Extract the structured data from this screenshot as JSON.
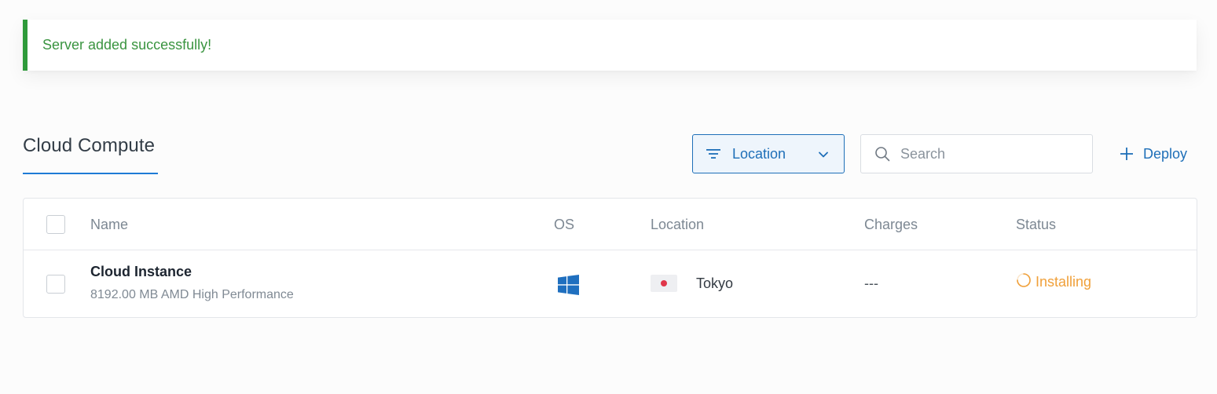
{
  "alert": {
    "message": "Server added successfully!",
    "color": "#2e9a3a"
  },
  "header": {
    "title": "Cloud Compute",
    "filter": {
      "label": "Location",
      "icon": "filter-icon",
      "chevron": "chevron-down-icon"
    },
    "search": {
      "placeholder": "Search",
      "value": "",
      "icon": "search-icon"
    },
    "deploy": {
      "label": "Deploy",
      "icon": "plus-icon"
    },
    "accent": "#1e6fb8"
  },
  "table": {
    "columns": [
      "Name",
      "OS",
      "Location",
      "Charges",
      "Status"
    ],
    "rows": [
      {
        "name": "Cloud Instance",
        "subtitle": "8192.00 MB AMD High Performance",
        "os_icon": "windows-icon",
        "flag_icon": "japan-flag-icon",
        "location": "Tokyo",
        "charges": "---",
        "status": "Installing",
        "status_icon": "spinner-icon",
        "status_color": "#f0a03a"
      }
    ]
  }
}
